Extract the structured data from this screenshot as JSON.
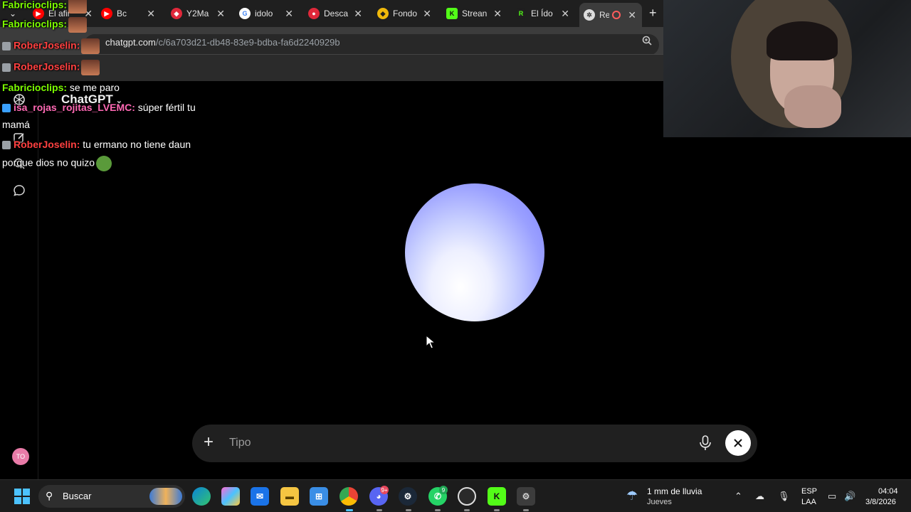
{
  "browser": {
    "tabs": [
      {
        "label": "El afir",
        "color": "#ff0000",
        "glyph": "▶"
      },
      {
        "label": "Bc",
        "color": "#ff0000",
        "glyph": "▶"
      },
      {
        "label": "Y2Ma",
        "color": "#e0283a",
        "glyph": "◆"
      },
      {
        "label": "idolo",
        "color": "#4285f4",
        "glyph": "G"
      },
      {
        "label": "Desca",
        "color": "#e0283a",
        "glyph": "●"
      },
      {
        "label": "Fondo",
        "color": "#f0b90b",
        "glyph": "◆"
      },
      {
        "label": "Strean",
        "color": "#53fc18",
        "glyph": "K"
      },
      {
        "label": "El Ído",
        "color": "#53fc18",
        "glyph": "R"
      },
      {
        "label": "Re",
        "color": "#cccccc",
        "glyph": "✲"
      }
    ],
    "url_domain": "chatgpt.com",
    "url_path": "/c/6a703d21-db48-83e9-bdba-fa6d2240929b"
  },
  "app": {
    "title": "ChatGPT",
    "composer_placeholder": "Tipo",
    "avatar_initials": "TO"
  },
  "chat": [
    {
      "user": "Fabricioclips:",
      "user_color": "#7cfc00",
      "text": "",
      "top": "a"
    },
    {
      "user": "Fabricioclips:",
      "user_color": "#7cfc00",
      "text": ""
    },
    {
      "user": "RoberJoselin:",
      "user_color": "#ff4040",
      "text": ""
    },
    {
      "user": "RoberJoselin:",
      "user_color": "#ff4040",
      "text": ""
    },
    {
      "user": "Fabricioclips:",
      "user_color": "#7cfc00",
      "text": " se me paro"
    },
    {
      "user": "isa_rojas_rojitas_LVEMC:",
      "user_color": "#ff69b4",
      "text": " súper fértil tu"
    },
    {
      "user": "",
      "user_color": "#ffffff",
      "text": "mamá"
    },
    {
      "user": "RoberJoselin:",
      "user_color": "#ff4040",
      "text": " tu ermano no tiene daun"
    },
    {
      "user": "",
      "user_color": "#ffffff",
      "text": "porque dios no quizo"
    }
  ],
  "taskbar": {
    "search_label": "Buscar",
    "weather_main": "1 mm de lluvia",
    "weather_sub": "Jueves",
    "lang_1": "ESP",
    "lang_2": "LAA",
    "time": "04:04",
    "date": "3/8/2026",
    "badges": {
      "discord": "9+",
      "whatsapp": "9"
    }
  },
  "colors": {
    "accent_orb": "#7b7dff",
    "chrome_bg": "#3c3c3c",
    "taskbar_bg": "#1c1c1c"
  }
}
